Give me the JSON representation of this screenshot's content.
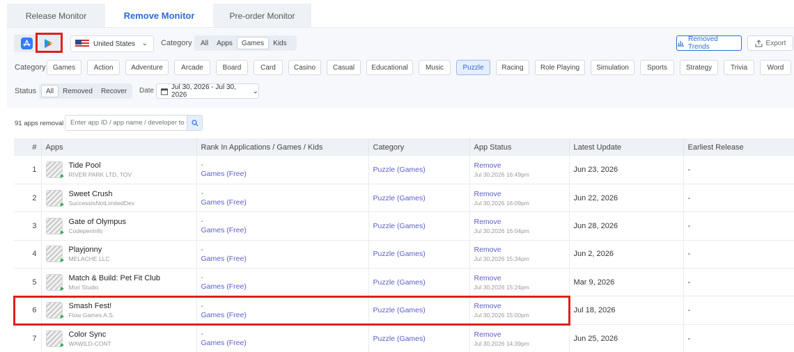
{
  "tabs": [
    {
      "label": "Release Monitor",
      "active": false
    },
    {
      "label": "Remove Monitor",
      "active": true
    },
    {
      "label": "Pre-order Monitor",
      "active": false
    }
  ],
  "store": {
    "selected": "google-play"
  },
  "country": {
    "label": "United States"
  },
  "filters": {
    "category_label": "Category",
    "type_options": [
      "All",
      "Apps",
      "Games",
      "Kids"
    ],
    "type_selected": "Games",
    "categories": [
      "Games",
      "Action",
      "Adventure",
      "Arcade",
      "Board",
      "Card",
      "Casino",
      "Casual",
      "Educational",
      "Music",
      "Puzzle",
      "Racing",
      "Role Playing",
      "Simulation",
      "Sports",
      "Strategy",
      "Trivia",
      "Word"
    ],
    "category_selected": "Puzzle",
    "status_label": "Status",
    "status_options": [
      "All",
      "Removed",
      "Recover"
    ],
    "status_selected": "All",
    "date_label": "Date",
    "date_range": "Jul 30, 2026 - Jul 30, 2026"
  },
  "actions": {
    "trends": "Removed Trends",
    "export": "Export"
  },
  "summary": {
    "count_text": "91 apps removal"
  },
  "search": {
    "placeholder": "Enter app ID / app name / developer to se"
  },
  "table": {
    "headers": [
      "#",
      "Apps",
      "Rank In Applications / Games / Kids",
      "Category",
      "App Status",
      "Latest Update",
      "Earliest Release"
    ],
    "rows": [
      {
        "num": "1",
        "name": "Tide Pool",
        "dev": "RIVER PARK LTD, TOV",
        "rank_dash": "-",
        "rank": "Games (Free)",
        "category": "Puzzle (Games)",
        "status": "Remove",
        "time": "Jul 30,2026 16:49pm",
        "latest": "Jun 23, 2026",
        "earliest": "-"
      },
      {
        "num": "2",
        "name": "Sweet Crush",
        "dev": "SuccessIsNotLimitedDev",
        "rank_dash": "-",
        "rank": "Games (Free)",
        "category": "Puzzle (Games)",
        "status": "Remove",
        "time": "Jul 30,2026 16:09pm",
        "latest": "Jun 22, 2026",
        "earliest": "-"
      },
      {
        "num": "3",
        "name": "Gate of Olympus",
        "dev": "CodepenInfo",
        "rank_dash": "-",
        "rank": "Games (Free)",
        "category": "Puzzle (Games)",
        "status": "Remove",
        "time": "Jul 30,2026 16:04pm",
        "latest": "Jun 28, 2026",
        "earliest": "-"
      },
      {
        "num": "4",
        "name": "Playjonny",
        "dev": "MELACHE LLC",
        "rank_dash": "-",
        "rank": "Games (Free)",
        "category": "Puzzle (Games)",
        "status": "Remove",
        "time": "Jul 30,2026 15:34pm",
        "latest": "Jun 2, 2026",
        "earliest": "-"
      },
      {
        "num": "5",
        "name": "Match & Build: Pet Fit Club",
        "dev": "Mori Studio",
        "rank_dash": "-",
        "rank": "Games (Free)",
        "category": "Puzzle (Games)",
        "status": "Remove",
        "time": "Jul 30,2026 15:24pm",
        "latest": "Mar 9, 2026",
        "earliest": "-"
      },
      {
        "num": "6",
        "name": "Smash Fest!",
        "dev": "Flow Games A.S.",
        "rank_dash": "-",
        "rank": "Games (Free)",
        "category": "Puzzle (Games)",
        "status": "Remove",
        "time": "Jul 30,2026 15:00pm",
        "latest": "Jul 18, 2026",
        "earliest": "-"
      },
      {
        "num": "7",
        "name": "Color Sync",
        "dev": "WAWILD-CONT",
        "rank_dash": "-",
        "rank": "Games (Free)",
        "category": "Puzzle (Games)",
        "status": "Remove",
        "time": "Jul 30,2026 14:39pm",
        "latest": "Jun 25, 2026",
        "earliest": "-"
      }
    ]
  },
  "colors": {
    "accent": "#2e6ad6",
    "link": "#5a5fc7",
    "highlight": "#e01f1f"
  }
}
